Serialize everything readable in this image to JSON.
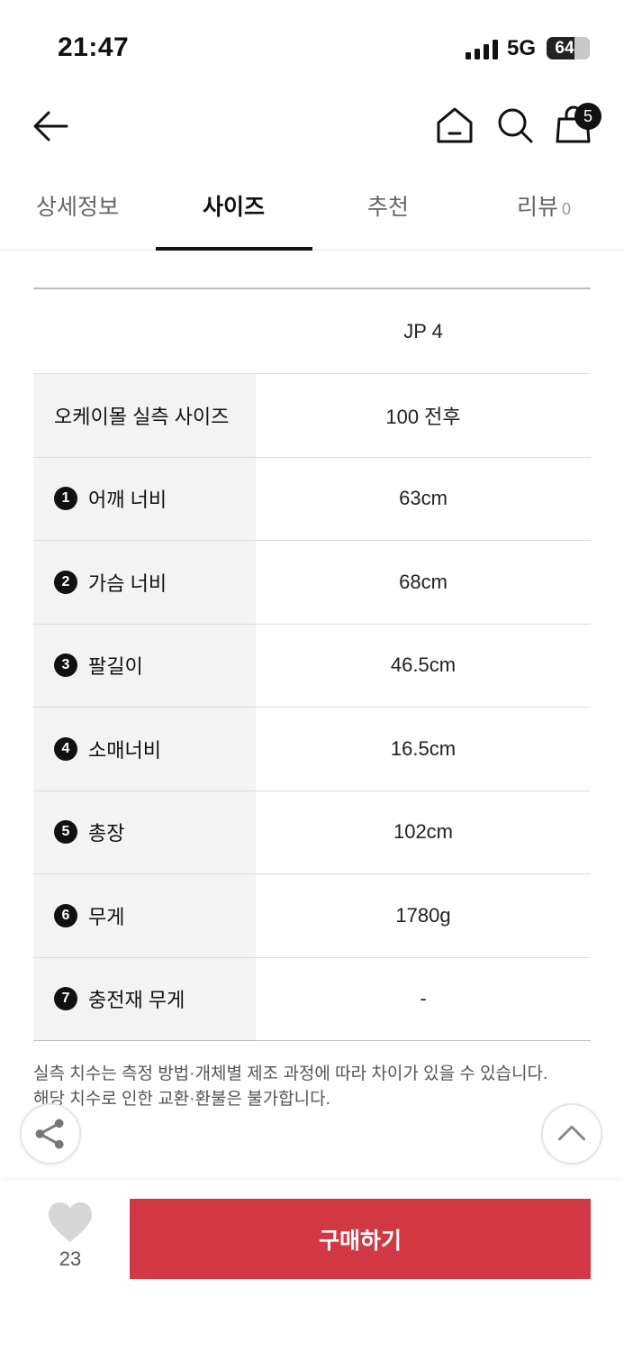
{
  "status_bar": {
    "time": "21:47",
    "network": "5G",
    "battery": "64"
  },
  "header": {
    "cart_count": "5"
  },
  "tabs": [
    {
      "label": "상세정보"
    },
    {
      "label": "사이즈"
    },
    {
      "label": "추천"
    },
    {
      "label": "리뷰",
      "count": "0"
    }
  ],
  "size_table": {
    "column_header": "JP 4",
    "rows": [
      {
        "num": "",
        "label": "오케이몰 실측 사이즈",
        "value": "100 전후"
      },
      {
        "num": "1",
        "label": "어깨 너비",
        "value": "63cm"
      },
      {
        "num": "2",
        "label": "가슴 너비",
        "value": "68cm"
      },
      {
        "num": "3",
        "label": "팔길이",
        "value": "46.5cm"
      },
      {
        "num": "4",
        "label": "소매너비",
        "value": "16.5cm"
      },
      {
        "num": "5",
        "label": "총장",
        "value": "102cm"
      },
      {
        "num": "6",
        "label": "무게",
        "value": "1780g"
      },
      {
        "num": "7",
        "label": "충전재 무게",
        "value": "-"
      }
    ]
  },
  "disclaimer": {
    "line1": "실측 치수는 측정 방법·개체별 제조 과정에 따라 차이가 있을 수 있습니다.",
    "line2": "해당 치수로 인한 교환·환불은 불가합니다."
  },
  "bottom_bar": {
    "like_count": "23",
    "buy_label": "구매하기"
  },
  "icons": [
    "back-arrow-icon",
    "home-icon",
    "search-icon",
    "shopping-bag-icon",
    "share-icon",
    "chevron-up-icon",
    "heart-icon"
  ],
  "colors": {
    "buy_button": "#d23744",
    "text": "#111111",
    "label_cell_bg": "#f3f3f3"
  }
}
